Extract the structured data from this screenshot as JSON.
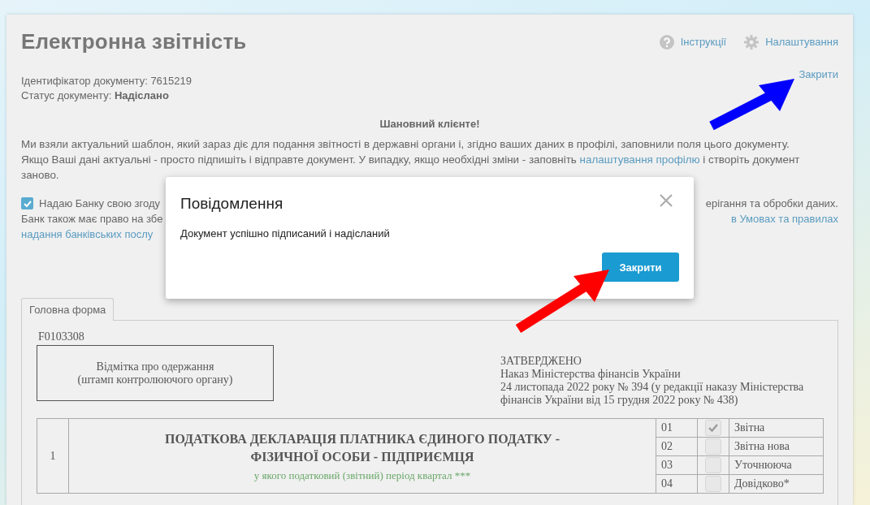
{
  "header": {
    "title": "Електронна звітність",
    "links": [
      {
        "kind": "help",
        "label": "Інструкції"
      },
      {
        "kind": "settings",
        "label": "Налаштування"
      }
    ]
  },
  "document": {
    "id_label": "Ідентифікатор документу: 7615219",
    "status_label": "Статус документу:",
    "status": "Надіслано",
    "close_link": "Закрити"
  },
  "greeting": "Шановний клієнте!",
  "intro": {
    "before": "Ми взяли актуальний шаблон, який зараз діє для подання звітності в державні органи і, згідно ваших даних в профілі, заповнили поля цього документу. Якщо Ваші дані актуальні - просто підпишіть і відправте документ. У випадку, якщо необхідні зміни - заповніть",
    "link": "налаштування профілю",
    "after": "і створіть документ заново."
  },
  "consent": {
    "checked": true,
    "lines": [
      {
        "left": {
          "text": "Надаю Банку свою згоду",
          "link": false
        },
        "right": {
          "text": "ерігання та обробки даних.",
          "link": false
        }
      },
      {
        "left": {
          "text": "Банк також має право на збе",
          "link": false
        },
        "right": {
          "text": "в Умовах та правилах",
          "link": true
        }
      },
      {
        "left": {
          "text": "надання банківських послу",
          "link": true
        }
      }
    ]
  },
  "modal": {
    "title": "Повідомлення",
    "message": "Документ успішно підписаний і надісланий",
    "button": "Закрити"
  },
  "form": {
    "tabs": [
      {
        "label": "Головна форма",
        "selected": true
      }
    ],
    "code": "F0103308",
    "stamp": [
      "Відмітка про одержання",
      "(штамп контролюючого органу)"
    ],
    "approval": [
      "ЗАТВЕРДЖЕНО",
      "Наказ Міністерства фінансів України",
      "24 листопада 2022 року № 394 (у редакції наказу Міністерства фінансів України від 15 грудня 2022 року № 438)"
    ],
    "row_number": "1",
    "declaration_title": "ПОДАТКОВА ДЕКЛАРАЦІЯ ПЛАТНИКА ЄДИНОГО ПОДАТКУ - ФІЗИЧНОЇ ОСОБИ - ПІДПРИЄМЦЯ",
    "declaration_subtitle": "у якого податковий (звітний) період квартал ***",
    "types": [
      {
        "code": "01",
        "checked": true,
        "label": "Звітна"
      },
      {
        "code": "02",
        "checked": false,
        "label": "Звітна нова"
      },
      {
        "code": "03",
        "checked": false,
        "label": "Уточнююча"
      },
      {
        "code": "04",
        "checked": false,
        "label": "Довідково*"
      }
    ]
  },
  "annotations": [
    {
      "kind": "arrow",
      "color": "#0000ff"
    },
    {
      "kind": "arrow",
      "color": "#ff0000"
    }
  ]
}
